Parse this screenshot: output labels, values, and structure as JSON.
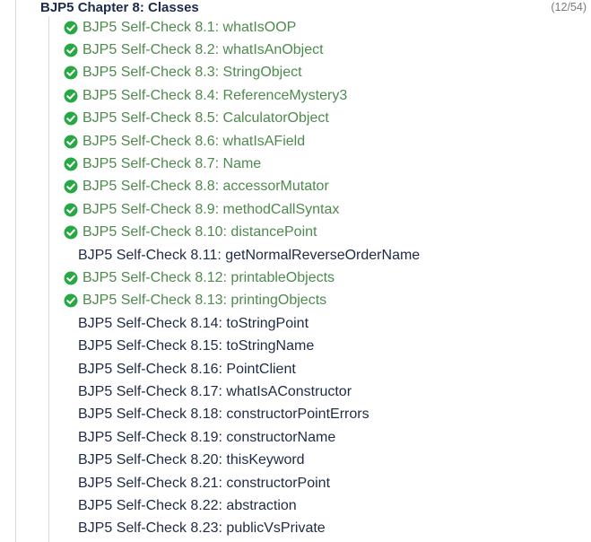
{
  "chapter": {
    "title": "BJP5 Chapter 8: Classes",
    "count": "(12/54)"
  },
  "colors": {
    "solved": "#4e8a4e",
    "check_icon": "#27a844",
    "unsolved": "#1f2b44"
  },
  "problems": [
    {
      "label": "BJP5 Self-Check 8.1: whatIsOOP",
      "solved": true,
      "icon": "check-circle-icon"
    },
    {
      "label": "BJP5 Self-Check 8.2: whatIsAnObject",
      "solved": true,
      "icon": "check-circle-icon"
    },
    {
      "label": "BJP5 Self-Check 8.3: StringObject",
      "solved": true,
      "icon": "check-circle-icon"
    },
    {
      "label": "BJP5 Self-Check 8.4: ReferenceMystery3",
      "solved": true,
      "icon": "check-circle-icon"
    },
    {
      "label": "BJP5 Self-Check 8.5: CalculatorObject",
      "solved": true,
      "icon": "check-circle-icon"
    },
    {
      "label": "BJP5 Self-Check 8.6: whatIsAField",
      "solved": true,
      "icon": "check-circle-icon"
    },
    {
      "label": "BJP5 Self-Check 8.7: Name",
      "solved": true,
      "icon": "check-circle-icon"
    },
    {
      "label": "BJP5 Self-Check 8.8: accessorMutator",
      "solved": true,
      "icon": "check-circle-icon"
    },
    {
      "label": "BJP5 Self-Check 8.9: methodCallSyntax",
      "solved": true,
      "icon": "check-circle-icon"
    },
    {
      "label": "BJP5 Self-Check 8.10: distancePoint",
      "solved": true,
      "icon": "check-circle-icon"
    },
    {
      "label": "BJP5 Self-Check 8.11: getNormalReverseOrderName",
      "solved": false
    },
    {
      "label": "BJP5 Self-Check 8.12: printableObjects",
      "solved": true,
      "icon": "check-circle-icon"
    },
    {
      "label": "BJP5 Self-Check 8.13: printingObjects",
      "solved": true,
      "icon": "check-circle-icon"
    },
    {
      "label": "BJP5 Self-Check 8.14: toStringPoint",
      "solved": false
    },
    {
      "label": "BJP5 Self-Check 8.15: toStringName",
      "solved": false
    },
    {
      "label": "BJP5 Self-Check 8.16: PointClient",
      "solved": false
    },
    {
      "label": "BJP5 Self-Check 8.17: whatIsAConstructor",
      "solved": false
    },
    {
      "label": "BJP5 Self-Check 8.18: constructorPointErrors",
      "solved": false
    },
    {
      "label": "BJP5 Self-Check 8.19: constructorName",
      "solved": false
    },
    {
      "label": "BJP5 Self-Check 8.20: thisKeyword",
      "solved": false
    },
    {
      "label": "BJP5 Self-Check 8.21: constructorPoint",
      "solved": false
    },
    {
      "label": "BJP5 Self-Check 8.22: abstraction",
      "solved": false
    },
    {
      "label": "BJP5 Self-Check 8.23: publicVsPrivate",
      "solved": false
    }
  ]
}
